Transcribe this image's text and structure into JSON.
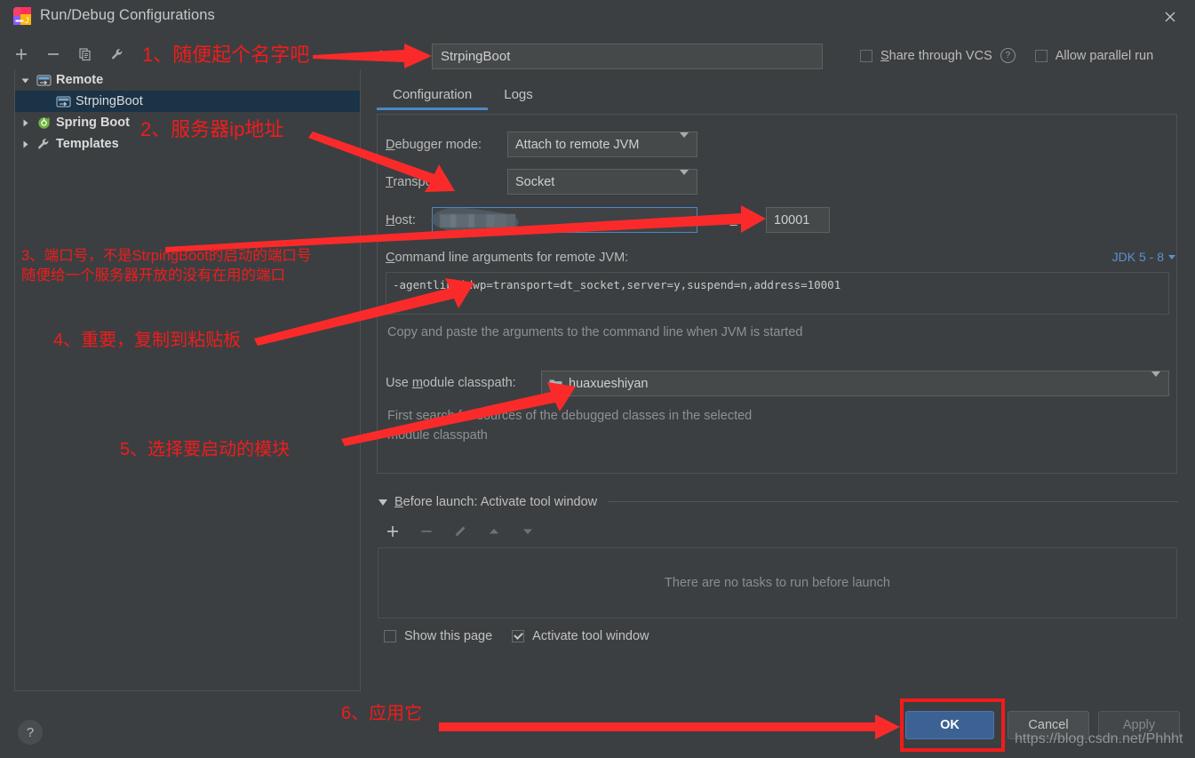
{
  "window": {
    "title": "Run/Debug Configurations",
    "close_icon": "close-icon",
    "app_icon": "intellij-idea-icon"
  },
  "sidebar": {
    "toolbar": [
      {
        "icon": "plus-icon",
        "label": "+"
      },
      {
        "icon": "minus-icon",
        "label": "−"
      },
      {
        "icon": "copy-icon",
        "label": "copy"
      },
      {
        "icon": "wrench-icon",
        "label": "wrench"
      }
    ],
    "tree": [
      {
        "label": "Remote",
        "icon": "remote-config-icon",
        "expanded": true,
        "level": 0,
        "selected": false
      },
      {
        "label": "StrpingBoot",
        "icon": "remote-config-icon",
        "expanded": null,
        "level": 1,
        "selected": true
      },
      {
        "label": "Spring Boot",
        "icon": "spring-boot-icon",
        "expanded": false,
        "level": 0,
        "selected": false
      },
      {
        "label": "Templates",
        "icon": "wrench-icon",
        "expanded": false,
        "level": 0,
        "selected": false
      }
    ]
  },
  "header": {
    "name_label": "Name:",
    "name_value": "StrpingBoot",
    "share_vcs_label": "Share through VCS",
    "share_vcs_checked": false,
    "help_icon": "question-mark-icon",
    "allow_parallel_label": "Allow parallel run",
    "allow_parallel_checked": false
  },
  "tabs": [
    {
      "label": "Configuration",
      "active": true
    },
    {
      "label": "Logs",
      "active": false
    }
  ],
  "configuration": {
    "debugger_mode_label": "Debugger mode:",
    "debugger_mode_value": "Attach to remote JVM",
    "transport_label": "Transport:",
    "transport_value": "Socket",
    "host_label": "Host:",
    "host_value": "",
    "port_label": "Port:",
    "port_value": "10001",
    "cmd_label": "Command line arguments for remote JVM:",
    "cmd_value": "-agentlib:jdwp=transport=dt_socket,server=y,suspend=n,address=10001",
    "jdk_link": "JDK 5 - 8",
    "cmd_hint": "Copy and paste the arguments to the command line when JVM is started",
    "module_classpath_label": "Use module classpath:",
    "module_classpath_value": "huaxueshiyan",
    "module_icon": "module-icon",
    "module_hint_line1": "First search for sources of the debugged classes in the selected",
    "module_hint_line2": "module classpath"
  },
  "before_launch": {
    "title": "Before launch: Activate tool window",
    "toolbar": [
      {
        "icon": "plus-icon",
        "enabled": true
      },
      {
        "icon": "minus-icon",
        "enabled": false
      },
      {
        "icon": "pencil-icon",
        "enabled": false
      },
      {
        "icon": "arrow-up-icon",
        "enabled": false
      },
      {
        "icon": "arrow-down-icon",
        "enabled": false
      }
    ],
    "empty_text": "There are no tasks to run before launch",
    "show_page_label": "Show this page",
    "show_page_checked": false,
    "activate_tool_window_label": "Activate tool window",
    "activate_tool_window_checked": true
  },
  "footer": {
    "help_label": "?",
    "ok_label": "OK",
    "cancel_label": "Cancel",
    "apply_label": "Apply"
  },
  "annotations": {
    "a1": "1、随便起个名字吧",
    "a2": "2、服务器ip地址",
    "a3_line1": "3、端口号，不是StrpingBoot的启动的端口号",
    "a3_line2": "随便给一个服务器开放的没有在用的端口",
    "a4": "4、重要，复制到粘贴板",
    "a5": "5、选择要启动的模块",
    "a6": "6、应用它",
    "color": "#f01c1c"
  },
  "watermark": "https://blog.csdn.net/Phhht"
}
